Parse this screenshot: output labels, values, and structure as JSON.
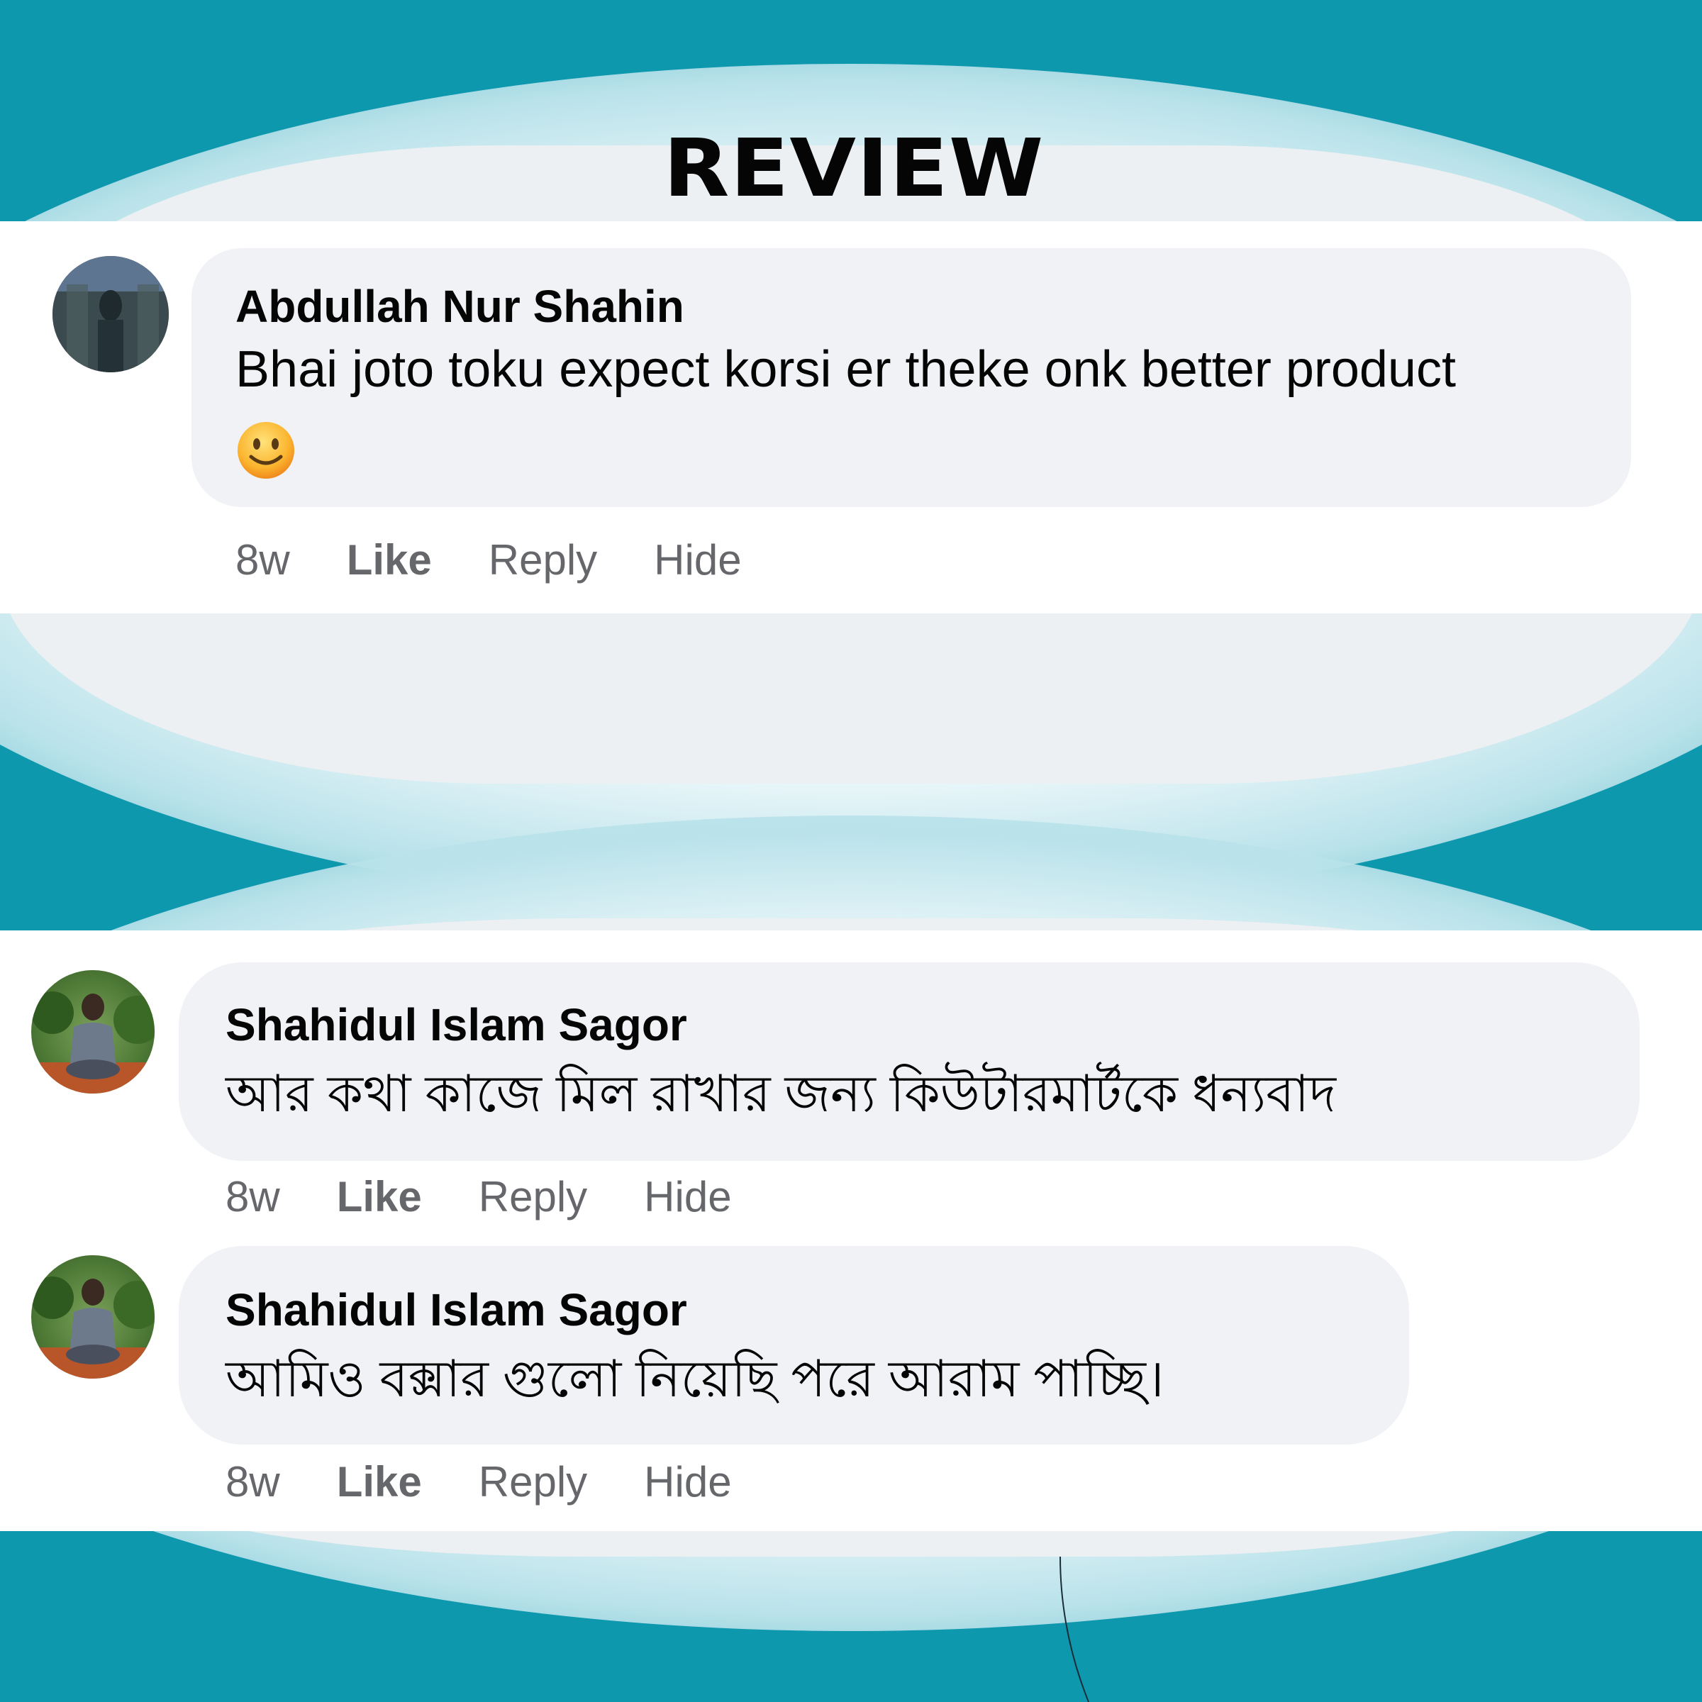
{
  "header": {
    "title": "REVIEW"
  },
  "comments": [
    {
      "author": "Abdullah Nur Shahin",
      "text": "Bhai joto toku expect korsi er theke onk better product",
      "emoji": "smiling-face",
      "time": "8w",
      "like": "Like",
      "reply": "Reply",
      "hide": "Hide"
    },
    {
      "author": "Shahidul Islam Sagor",
      "text": "আর কথা কাজে মিল রাখার জন্য কিউটারমার্টকে ধন্যবাদ",
      "time": "8w",
      "like": "Like",
      "reply": "Reply",
      "hide": "Hide"
    },
    {
      "author": "Shahidul Islam Sagor",
      "text": "আমিও বক্সার গুলো নিয়েছি পরে আরাম পাচ্ছি।",
      "time": "8w",
      "like": "Like",
      "reply": "Reply",
      "hide": "Hide"
    }
  ],
  "colors": {
    "background_teal": "#0e98ae",
    "panel_gray": "#edf0f3",
    "bubble": "#f0f2f5",
    "text": "#050505",
    "meta": "#65676b"
  }
}
